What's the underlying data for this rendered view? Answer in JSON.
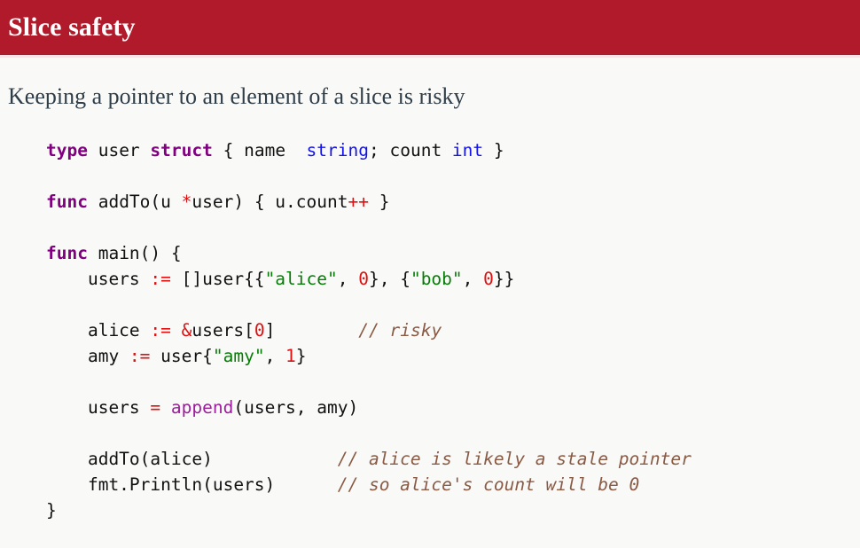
{
  "slide": {
    "title": "Slice safety",
    "lead": "Keeping a pointer to an element of a slice is risky",
    "accent_color": "#b01a2a",
    "background_color": "#f9f9f7",
    "title_text_color": "#ffffff",
    "lead_text_color": "#2e3d47"
  },
  "code": {
    "language": "go",
    "syntax_colors": {
      "keyword": "#800080",
      "type": "#1414e6",
      "string": "#067d06",
      "number": "#dd1111",
      "operator": "#dd1111",
      "builtin": "#9d1d9d",
      "comment": "#8a5a44",
      "plain": "#111111"
    },
    "lines": [
      {
        "index": 0,
        "text": "type user struct { name  string; count int }",
        "tokens": [
          {
            "t": "type",
            "c": "kw"
          },
          {
            "t": " user ",
            "c": "pln"
          },
          {
            "t": "struct",
            "c": "kw"
          },
          {
            "t": " { name  ",
            "c": "pln"
          },
          {
            "t": "string",
            "c": "typ"
          },
          {
            "t": "; count ",
            "c": "pln"
          },
          {
            "t": "int",
            "c": "typ"
          },
          {
            "t": " }",
            "c": "pln"
          }
        ]
      },
      {
        "index": 1,
        "text": "",
        "tokens": []
      },
      {
        "index": 2,
        "text": "func addTo(u *user) { u.count++ }",
        "tokens": [
          {
            "t": "func",
            "c": "kw"
          },
          {
            "t": " addTo(u ",
            "c": "pln"
          },
          {
            "t": "*",
            "c": "op"
          },
          {
            "t": "user) { u.count",
            "c": "pln"
          },
          {
            "t": "++",
            "c": "op"
          },
          {
            "t": " }",
            "c": "pln"
          }
        ]
      },
      {
        "index": 3,
        "text": "",
        "tokens": []
      },
      {
        "index": 4,
        "text": "func main() {",
        "tokens": [
          {
            "t": "func",
            "c": "kw"
          },
          {
            "t": " main() {",
            "c": "pln"
          }
        ]
      },
      {
        "index": 5,
        "text": "    users := []user{{\"alice\", 0}, {\"bob\", 0}}",
        "tokens": [
          {
            "t": "    users ",
            "c": "pln"
          },
          {
            "t": ":=",
            "c": "op"
          },
          {
            "t": " []user{{",
            "c": "pln"
          },
          {
            "t": "\"alice\"",
            "c": "str"
          },
          {
            "t": ", ",
            "c": "pln"
          },
          {
            "t": "0",
            "c": "num"
          },
          {
            "t": "}, {",
            "c": "pln"
          },
          {
            "t": "\"bob\"",
            "c": "str"
          },
          {
            "t": ", ",
            "c": "pln"
          },
          {
            "t": "0",
            "c": "num"
          },
          {
            "t": "}}",
            "c": "pln"
          }
        ]
      },
      {
        "index": 6,
        "text": "",
        "tokens": []
      },
      {
        "index": 7,
        "text": "    alice := &users[0]        // risky",
        "tokens": [
          {
            "t": "    alice ",
            "c": "pln"
          },
          {
            "t": ":=",
            "c": "op"
          },
          {
            "t": " ",
            "c": "pln"
          },
          {
            "t": "&",
            "c": "op"
          },
          {
            "t": "users[",
            "c": "pln"
          },
          {
            "t": "0",
            "c": "num"
          },
          {
            "t": "]",
            "c": "pln"
          },
          {
            "t": "        ",
            "c": "pln"
          },
          {
            "t": "// risky",
            "c": "cmt"
          }
        ]
      },
      {
        "index": 8,
        "text": "    amy := user{\"amy\", 1}",
        "tokens": [
          {
            "t": "    amy ",
            "c": "pln"
          },
          {
            "t": ":=",
            "c": "op"
          },
          {
            "t": " user{",
            "c": "pln"
          },
          {
            "t": "\"amy\"",
            "c": "str"
          },
          {
            "t": ", ",
            "c": "pln"
          },
          {
            "t": "1",
            "c": "num"
          },
          {
            "t": "}",
            "c": "pln"
          }
        ]
      },
      {
        "index": 9,
        "text": "",
        "tokens": []
      },
      {
        "index": 10,
        "text": "    users = append(users, amy)",
        "tokens": [
          {
            "t": "    users ",
            "c": "pln"
          },
          {
            "t": "=",
            "c": "op"
          },
          {
            "t": " ",
            "c": "pln"
          },
          {
            "t": "append",
            "c": "bi"
          },
          {
            "t": "(users, amy)",
            "c": "pln"
          }
        ]
      },
      {
        "index": 11,
        "text": "",
        "tokens": []
      },
      {
        "index": 12,
        "text": "    addTo(alice)            // alice is likely a stale pointer",
        "tokens": [
          {
            "t": "    addTo(alice)",
            "c": "pln"
          },
          {
            "t": "            ",
            "c": "pln"
          },
          {
            "t": "// alice is likely a stale pointer",
            "c": "cmt"
          }
        ]
      },
      {
        "index": 13,
        "text": "    fmt.Println(users)      // so alice's count will be 0",
        "tokens": [
          {
            "t": "    fmt.Println(users)",
            "c": "pln"
          },
          {
            "t": "      ",
            "c": "pln"
          },
          {
            "t": "// so alice's count will be 0",
            "c": "cmt"
          }
        ]
      },
      {
        "index": 14,
        "text": "}",
        "tokens": [
          {
            "t": "}",
            "c": "pln"
          }
        ]
      }
    ]
  }
}
